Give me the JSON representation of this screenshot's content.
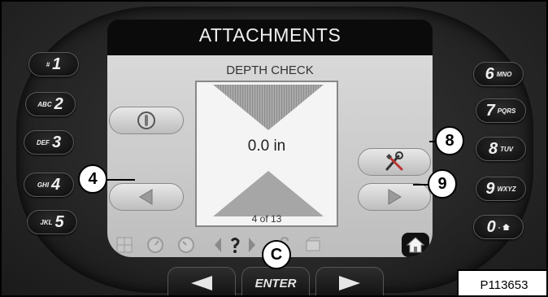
{
  "screen": {
    "title": "ATTACHMENTS",
    "subtitle": "DEPTH CHECK",
    "depth_value": "0.0 in",
    "page_count": "4 of 13"
  },
  "keys_left": [
    {
      "letters": "#",
      "digit": "1"
    },
    {
      "letters": "ABC",
      "digit": "2"
    },
    {
      "letters": "DEF",
      "digit": "3"
    },
    {
      "letters": "GHI",
      "digit": "4"
    },
    {
      "letters": "JKL",
      "digit": "5"
    }
  ],
  "keys_right": [
    {
      "digit": "6",
      "letters": "MNO"
    },
    {
      "digit": "7",
      "letters": "PQRS"
    },
    {
      "digit": "8",
      "letters": "TUV"
    },
    {
      "digit": "9",
      "letters": "WXYZ"
    },
    {
      "digit": "0",
      "letters": "-"
    }
  ],
  "bottom_keys": {
    "enter_label": "ENTER"
  },
  "callouts": {
    "left_arrow": "4",
    "tools": "8",
    "right_arrow": "9",
    "enter": "C"
  },
  "figure_id": "P113653",
  "icons": {
    "power": "power-icon",
    "prev": "left-triangle-icon",
    "tools": "wrench-screwdriver-icon",
    "next": "right-triangle-icon",
    "home": "home-icon"
  },
  "colors": {
    "lcd_background": "#c9c9c9",
    "bezel": "#262626",
    "key_text": "#f0f0f0"
  }
}
